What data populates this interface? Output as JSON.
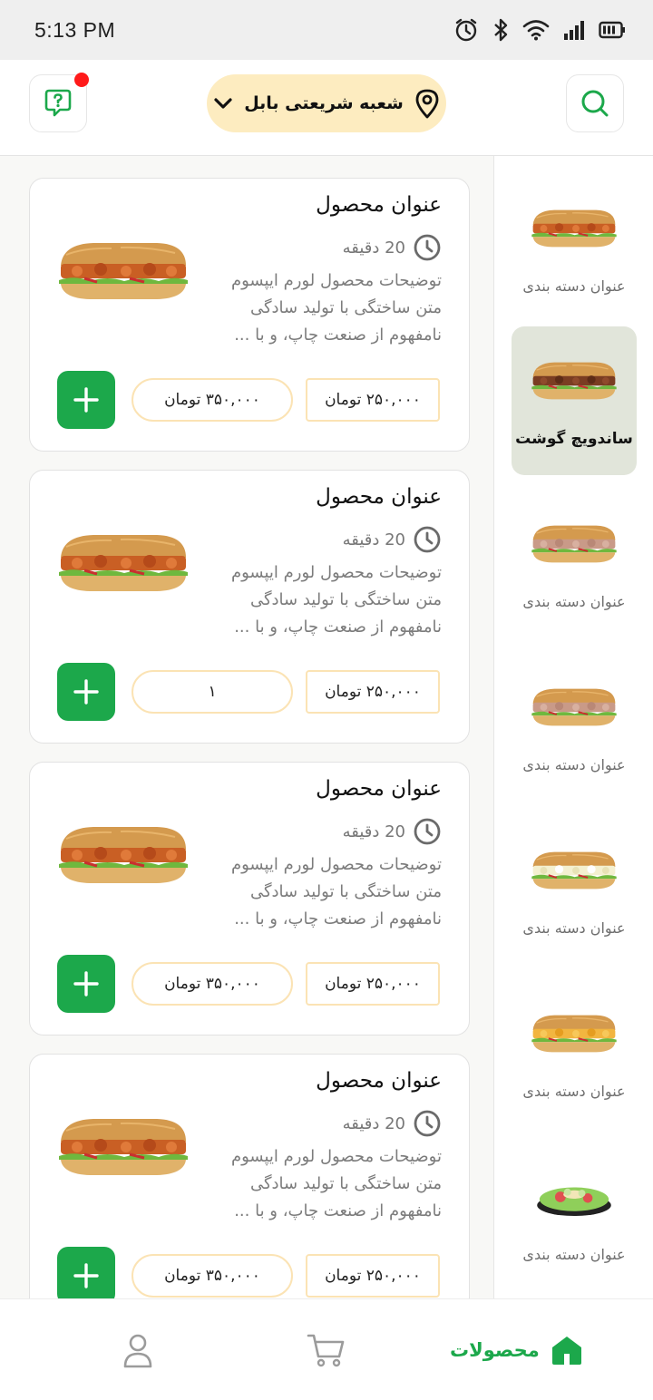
{
  "status_bar": {
    "time": "5:13 PM",
    "icons": [
      "alarm-icon",
      "bluetooth-icon",
      "wifi-icon",
      "signal-icon",
      "battery-icon"
    ]
  },
  "header": {
    "branch_label": "شعبه شریعتی بابل",
    "icons": [
      "help-chat-icon",
      "location-pin-icon",
      "chevron-down-icon",
      "search-icon"
    ]
  },
  "categories": [
    {
      "label": "عنوان دسته بندی",
      "active": false
    },
    {
      "label": "ساندویچ گوشت",
      "active": true
    },
    {
      "label": "عنوان دسته بندی",
      "active": false
    },
    {
      "label": "عنوان دسته بندی",
      "active": false
    },
    {
      "label": "عنوان دسته بندی",
      "active": false
    },
    {
      "label": "عنوان دسته بندی",
      "active": false
    },
    {
      "label": "عنوان دسته بندی",
      "active": false
    }
  ],
  "products": [
    {
      "title": "عنوان محصول",
      "time": "20 دقیقه",
      "description": "توضیحات محصول لورم ایپسوم متن ساختگی با تولید سادگی نامفهوم از صنعت چاپ، و با ...",
      "price": "۲۵۰,۰۰۰ تومان",
      "second_pill": "۳۵۰,۰۰۰ تومان"
    },
    {
      "title": "عنوان محصول",
      "time": "20 دقیقه",
      "description": "توضیحات محصول لورم ایپسوم متن ساختگی با تولید سادگی نامفهوم از صنعت چاپ، و با ...",
      "price": "۲۵۰,۰۰۰ تومان",
      "second_pill": "۱"
    },
    {
      "title": "عنوان محصول",
      "time": "20 دقیقه",
      "description": "توضیحات محصول لورم ایپسوم متن ساختگی با تولید سادگی نامفهوم از صنعت چاپ، و با ...",
      "price": "۲۵۰,۰۰۰ تومان",
      "second_pill": "۳۵۰,۰۰۰ تومان"
    },
    {
      "title": "عنوان محصول",
      "time": "20 دقیقه",
      "description": "توضیحات محصول لورم ایپسوم متن ساختگی با تولید سادگی نامفهوم از صنعت چاپ، و با ...",
      "price": "۲۵۰,۰۰۰ تومان",
      "second_pill": "۳۵۰,۰۰۰ تومان"
    }
  ],
  "bottom_nav": {
    "products_label": "محصولات",
    "icons": [
      "home-icon",
      "cart-icon",
      "profile-icon"
    ]
  },
  "colors": {
    "accent_green": "#1ca84b",
    "branch_pill_bg": "#fdecc0",
    "active_category_bg": "#e1e5da",
    "notification_red": "#ff1a1a"
  }
}
